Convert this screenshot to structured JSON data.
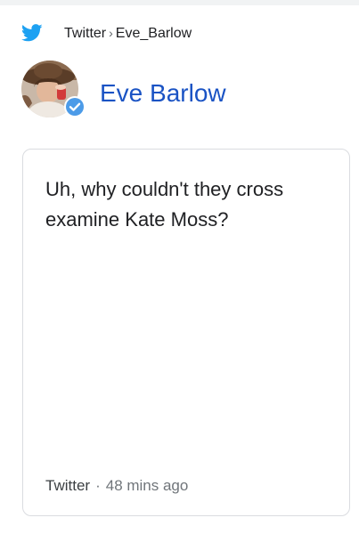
{
  "breadcrumb": {
    "icon": "twitter-bird-icon",
    "site": "Twitter",
    "separator": "›",
    "handle": "Eve_Barlow"
  },
  "author": {
    "name": "Eve Barlow",
    "avatar": "avatar",
    "verified_icon": "verified-badge-icon"
  },
  "tweet": {
    "text": "Uh, why couldn't they cross examine Kate Moss?",
    "source": "Twitter",
    "dot": "·",
    "time": "48 mins ago"
  },
  "colors": {
    "twitter_blue": "#1da1f2",
    "link_blue": "#1a53c4",
    "card_border": "#dadce0"
  }
}
